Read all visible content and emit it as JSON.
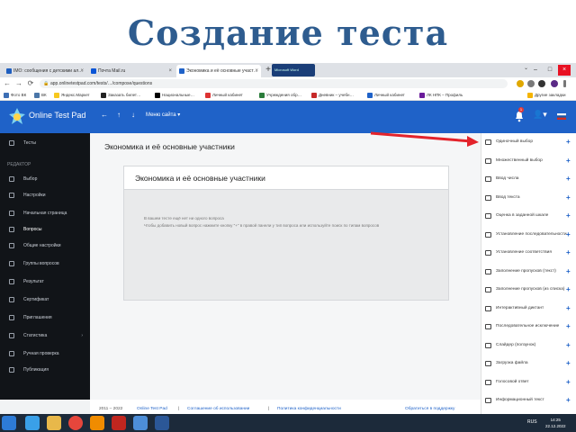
{
  "slide": {
    "title": "Создание теста"
  },
  "browser": {
    "tabs": [
      {
        "label": "IMO: сообщения с детскими ал…",
        "color": "#1f5fbf"
      },
      {
        "label": "Почта Mail.ru",
        "color": "#0b55d6"
      },
      {
        "label": "Экономика и её основные участ…",
        "color": "#1f62c8",
        "active": true
      }
    ],
    "new_tab": "+",
    "other_tab": "Microsoft Word",
    "url": "app.onlinetestpad.com/tests/…/compose/questions",
    "bookmarks": [
      {
        "label": "Фото ВК",
        "color": "#3d6fb5"
      },
      {
        "label": "ВК",
        "color": "#4a76a8"
      },
      {
        "label": "Яндекс.Маркет",
        "color": "#f7c81e"
      },
      {
        "label": "Заказать билет…",
        "color": "#222222"
      },
      {
        "label": "Национальные…",
        "color": "#000000"
      },
      {
        "label": "Личный кабинет",
        "color": "#d33"
      },
      {
        "label": "Учреждения обр…",
        "color": "#2a7c3a"
      },
      {
        "label": "Дневник – учебн…",
        "color": "#c62828"
      },
      {
        "label": "Личный кабинет",
        "color": "#1f62c8"
      },
      {
        "label": "ЛК НПК – Профиль",
        "color": "#6a1b9a"
      },
      {
        "label": "Другие закладки",
        "color": "#f5b400"
      }
    ]
  },
  "app": {
    "name": "Online Test Pad",
    "menu_label": "Меню сайта ▾",
    "notifications_count": "1",
    "sidebar_heading": "РЕДАКТОР",
    "sidebar_items": [
      {
        "label": "Тесты",
        "icon": "tests-icon"
      },
      {
        "label": "Выбор",
        "icon": "choice-icon"
      },
      {
        "label": "Настройки",
        "icon": "settings-icon"
      },
      {
        "label": "Начальная страница",
        "icon": "start-page-icon"
      },
      {
        "label": "Вопросы",
        "icon": "questions-icon",
        "active": true
      },
      {
        "label": "Общие настройки",
        "icon": "general-settings-icon"
      },
      {
        "label": "Группы вопросов",
        "icon": "groups-icon"
      },
      {
        "label": "Результат",
        "icon": "result-icon"
      },
      {
        "label": "Сертификат",
        "icon": "certificate-icon"
      },
      {
        "label": "Приглашения",
        "icon": "invite-icon"
      },
      {
        "label": "Статистика",
        "icon": "stats-icon",
        "has_arrow": true
      },
      {
        "label": "Ручная проверка",
        "icon": "manual-check-icon"
      },
      {
        "label": "Публикация",
        "icon": "publish-icon"
      }
    ],
    "page_title": "Экономика и её основные участники",
    "card_title": "Экономика и её основные участники",
    "card_lines": [
      "В вашем тесте ещё нет ни одного вопроса",
      "Чтобы добавить новый вопрос нажмите кнопку \"+\" в правой панели у тип вопроса или используйте поиск по типам вопросов"
    ],
    "footer": [
      {
        "text": "2011 – 2022",
        "link": false
      },
      {
        "text": "Online Test Pad",
        "link": true
      },
      {
        "text": "|",
        "link": false
      },
      {
        "text": "Соглашение об использовании",
        "link": true
      },
      {
        "text": "|",
        "link": false
      },
      {
        "text": "Политика конфиденциальности",
        "link": true
      },
      {
        "text": "Обратиться в поддержку",
        "link": true
      }
    ],
    "question_types": [
      "Одиночный выбор",
      "Множественный выбор",
      "Ввод числа",
      "Ввод текста",
      "Оценка в заданной шкале",
      "Установление последовательности",
      "Установление соответствия",
      "Заполнение пропусков (текст)",
      "Заполнение пропусков (из списка)",
      "Интерактивный диктант",
      "Последовательное исключение",
      "Слайдер (ползунок)",
      "Загрузка файла",
      "Голосовой ответ",
      "Информационный текст",
      "Слово из букв"
    ],
    "add_symbol": "+"
  },
  "taskbar": {
    "lang": "RUS",
    "time": "14:25",
    "date": "22.12.2022",
    "icons": [
      {
        "name": "start-icon",
        "color": "#2d7bd6"
      },
      {
        "name": "ie-icon",
        "color": "#3aa0e8"
      },
      {
        "name": "explorer-icon",
        "color": "#e8b84a"
      },
      {
        "name": "chrome-icon",
        "color": "#e6463c"
      },
      {
        "name": "media-icon",
        "color": "#f08c00"
      },
      {
        "name": "filezilla-icon",
        "color": "#c0261f"
      },
      {
        "name": "files-icon",
        "color": "#4d8ed8"
      },
      {
        "name": "word-icon",
        "color": "#2b5797"
      }
    ]
  },
  "colors": {
    "brand_blue": "#1f62c8",
    "slide_title": "#2e5c8f",
    "sidebar_bg": "#111418",
    "arrow_red": "#e3232b"
  }
}
